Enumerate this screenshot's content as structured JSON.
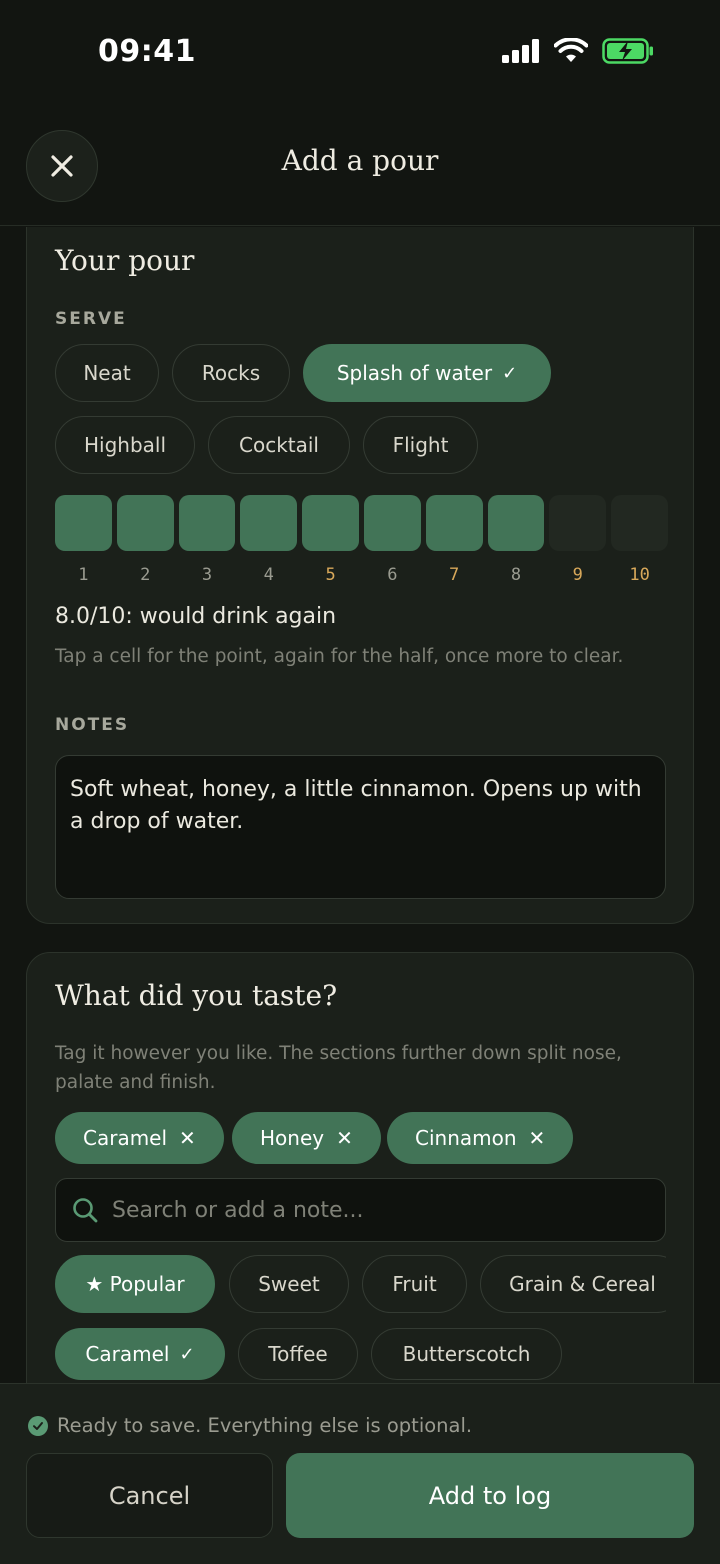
{
  "status_bar": {
    "time": "09:41"
  },
  "header": {
    "title": "Add a pour"
  },
  "pour": {
    "title": "Your pour",
    "serve_label": "SERVE",
    "serve_options": [
      {
        "label": "Neat",
        "selected": false
      },
      {
        "label": "Rocks",
        "selected": false
      },
      {
        "label": "Splash of water",
        "selected": true
      },
      {
        "label": "Highball",
        "selected": false
      },
      {
        "label": "Cocktail",
        "selected": false
      },
      {
        "label": "Flight",
        "selected": false
      }
    ],
    "rating": {
      "value": 8.0,
      "max": 10,
      "ticks": [
        "1",
        "2",
        "3",
        "4",
        "5",
        "6",
        "7",
        "8",
        "9",
        "10"
      ],
      "highlighted_ticks": [
        "5",
        "7",
        "9",
        "10"
      ],
      "summary": "8.0/10: would drink again",
      "hint": "Tap a cell for the point, again for the half, once more to clear."
    },
    "notes_label": "NOTES",
    "notes_value": "Soft wheat, honey, a little cinnamon. Opens up with a drop of water."
  },
  "taste": {
    "title": "What did you taste?",
    "hint": "Tag it however you like. The sections further down split nose, palate and finish.",
    "selected_tags": [
      "Caramel",
      "Honey",
      "Cinnamon"
    ],
    "search_placeholder": "Search or add a note...",
    "categories": [
      {
        "label": "★ Popular",
        "selected": true
      },
      {
        "label": "Sweet",
        "selected": false
      },
      {
        "label": "Fruit",
        "selected": false
      },
      {
        "label": "Grain & Cereal",
        "selected": false
      }
    ],
    "suggestions": [
      {
        "label": "Caramel",
        "selected": true
      },
      {
        "label": "Toffee",
        "selected": false
      },
      {
        "label": "Butterscotch",
        "selected": false
      }
    ]
  },
  "footer": {
    "ready_text": "Ready to save. Everything else is optional.",
    "cancel_label": "Cancel",
    "add_label": "Add to log"
  },
  "colors": {
    "accent": "#427457",
    "background": "#121511",
    "card": "#1b201a",
    "gold": "#d8a85a",
    "battery": "#4cd964"
  }
}
